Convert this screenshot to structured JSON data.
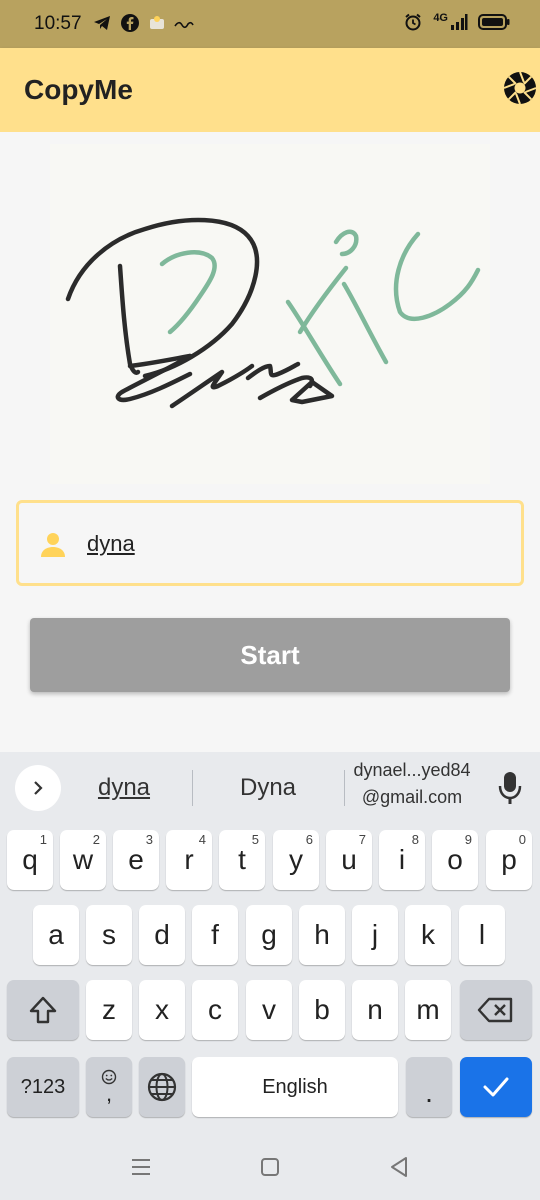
{
  "status_bar": {
    "time": "10:57",
    "network": "4G",
    "icons_left": [
      "telegram-icon",
      "facebook-icon",
      "notification-icon",
      "arabic-app-icon"
    ],
    "icons_right": [
      "alarm-icon",
      "signal-icon",
      "battery-icon"
    ]
  },
  "app_bar": {
    "title": "CopyMe",
    "action_icon": "camera-shutter-icon",
    "background": "#ffe08c"
  },
  "signature": {
    "stroke_colors": [
      "#2b2b2b",
      "#7fb89a"
    ]
  },
  "name_field": {
    "value": "dyna",
    "icon": "person-icon",
    "border_color": "#ffe08c"
  },
  "start_button": {
    "label": "Start",
    "background": "#9e9e9e"
  },
  "keyboard": {
    "suggestions": [
      "dyna",
      "Dyna"
    ],
    "email_suggestion": {
      "line1": "dynael...yed84",
      "line2": "@gmail.com"
    },
    "row1": [
      {
        "key": "q",
        "hint": "1"
      },
      {
        "key": "w",
        "hint": "2"
      },
      {
        "key": "e",
        "hint": "3"
      },
      {
        "key": "r",
        "hint": "4"
      },
      {
        "key": "t",
        "hint": "5"
      },
      {
        "key": "y",
        "hint": "6"
      },
      {
        "key": "u",
        "hint": "7"
      },
      {
        "key": "i",
        "hint": "8"
      },
      {
        "key": "o",
        "hint": "9"
      },
      {
        "key": "p",
        "hint": "0"
      }
    ],
    "row2": [
      "a",
      "s",
      "d",
      "f",
      "g",
      "h",
      "j",
      "k",
      "l"
    ],
    "row3": [
      "z",
      "x",
      "c",
      "v",
      "b",
      "n",
      "m"
    ],
    "symbols_label": "?123",
    "comma_label": ",",
    "space_label": "English",
    "period_label": ".",
    "accent_color": "#1a73e8"
  },
  "nav_bar": {
    "icons": [
      "recents-icon",
      "home-icon",
      "back-icon"
    ]
  }
}
